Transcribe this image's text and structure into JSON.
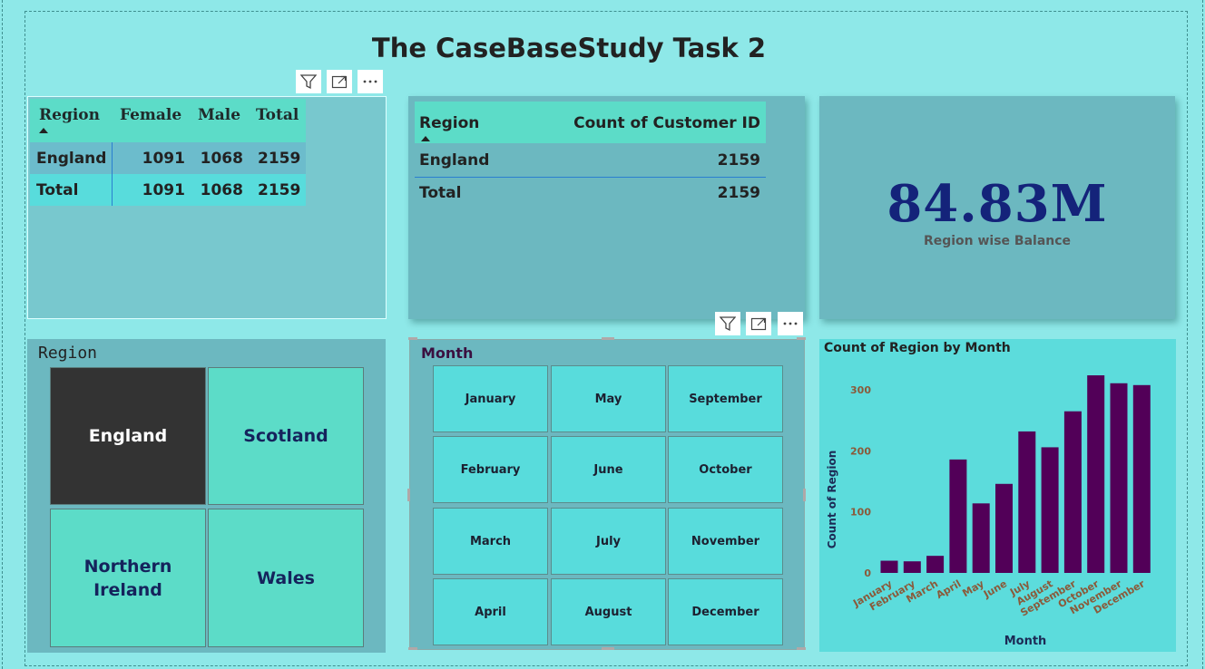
{
  "title": "The CaseBaseStudy Task 2",
  "matrix": {
    "headers": [
      "Region",
      "Female",
      "Male",
      "Total"
    ],
    "rows": [
      {
        "region": "England",
        "female": "1091",
        "male": "1068",
        "total": "2159"
      },
      {
        "region": "Total",
        "female": "1091",
        "male": "1068",
        "total": "2159"
      }
    ]
  },
  "table": {
    "headers": [
      "Region",
      "Count of Customer ID"
    ],
    "rows": [
      {
        "region": "England",
        "count": "2159"
      },
      {
        "region": "Total",
        "count": "2159"
      }
    ]
  },
  "card": {
    "value": "84.83M",
    "label": "Region wise Balance"
  },
  "region_slicer": {
    "title": "Region",
    "items": [
      "England",
      "Scotland",
      "Northern Ireland",
      "Wales"
    ],
    "selected": "England"
  },
  "month_slicer": {
    "title": "Month",
    "items": [
      "January",
      "May",
      "September",
      "February",
      "June",
      "October",
      "March",
      "July",
      "November",
      "April",
      "August",
      "December"
    ]
  },
  "colors": {
    "background": "#8ee8e8",
    "panel": "#6cb8c0",
    "header_teal": "#5cdcc8",
    "bar": "#520058",
    "kpi": "#14237a",
    "selected_tile": "#333333"
  },
  "icons": [
    "filter-icon",
    "focus-mode-icon",
    "more-options-icon"
  ],
  "chart_data": {
    "type": "bar",
    "title": "Count of Region by Month",
    "xlabel": "Month",
    "ylabel": "Count of Region",
    "categories": [
      "January",
      "February",
      "March",
      "April",
      "May",
      "June",
      "July",
      "August",
      "September",
      "October",
      "November",
      "December"
    ],
    "values": [
      20,
      19,
      28,
      186,
      114,
      146,
      232,
      206,
      265,
      324,
      311,
      308
    ],
    "yticks": [
      "0",
      "100",
      "200",
      "300"
    ],
    "ylim": [
      0,
      330
    ],
    "grid": false
  }
}
